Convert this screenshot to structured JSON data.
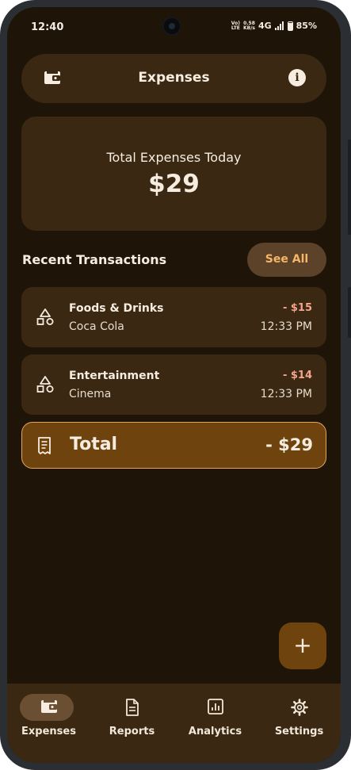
{
  "status_bar": {
    "time": "12:40",
    "network_top": "Vo)",
    "network_bottom": "LTE",
    "speed_top": "0.58",
    "speed_bottom": "KB/s",
    "signal": "4G",
    "battery": "85%"
  },
  "app_bar": {
    "title": "Expenses",
    "left_icon": "wallet-icon",
    "right_icon": "info-icon",
    "info_glyph": "i"
  },
  "summary": {
    "label": "Total Expenses Today",
    "amount": "$29"
  },
  "recent": {
    "title": "Recent Transactions",
    "see_all_label": "See All"
  },
  "transactions": [
    {
      "category": "Foods & Drinks",
      "description": "Coca Cola",
      "amount": "- $15",
      "time": "12:33 PM"
    },
    {
      "category": "Entertainment",
      "description": "Cinema",
      "amount": "- $14",
      "time": "12:33 PM"
    }
  ],
  "total": {
    "label": "Total",
    "value": "- $29"
  },
  "fab": {
    "label": "+"
  },
  "bottom_nav": [
    {
      "label": "Expenses",
      "icon": "wallet-icon",
      "active": true
    },
    {
      "label": "Reports",
      "icon": "document-icon",
      "active": false
    },
    {
      "label": "Analytics",
      "icon": "bar-chart-icon",
      "active": false
    },
    {
      "label": "Settings",
      "icon": "gear-icon",
      "active": false
    }
  ],
  "colors": {
    "background": "#1f1408",
    "surface": "#3a2812",
    "accent": "#f7b56a",
    "total_card": "#6e430d",
    "negative_amount": "#f5a48e"
  }
}
